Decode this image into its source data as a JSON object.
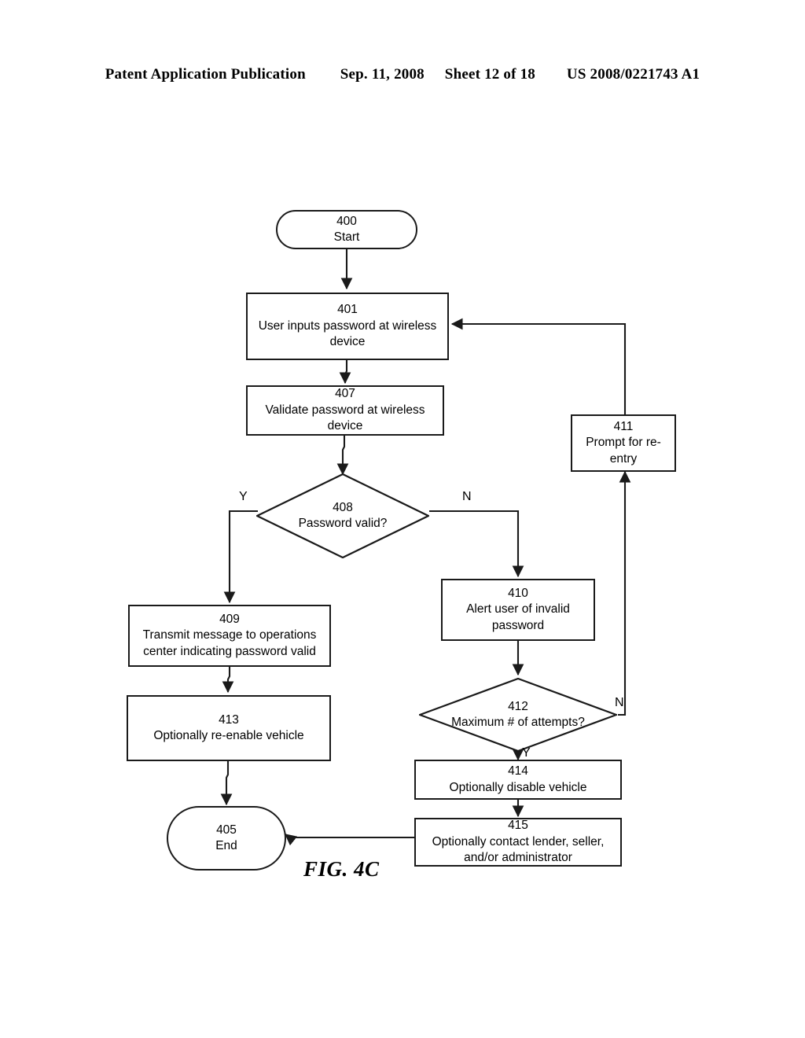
{
  "header": {
    "publication": "Patent Application Publication",
    "date": "Sep. 11, 2008",
    "sheet": "Sheet 12 of 18",
    "patent_number": "US 2008/0221743 A1"
  },
  "figure": {
    "caption": "FIG. 4C"
  },
  "nodes": {
    "n400": {
      "num": "400",
      "text": "Start"
    },
    "n401": {
      "num": "401",
      "text": "User inputs password at wireless device"
    },
    "n407": {
      "num": "407",
      "text": "Validate password at wireless device"
    },
    "n408": {
      "num": "408",
      "text": "Password valid?"
    },
    "n411": {
      "num": "411",
      "text": "Prompt for re-entry"
    },
    "n409": {
      "num": "409",
      "text": "Transmit message to operations center indicating password valid"
    },
    "n410": {
      "num": "410",
      "text": "Alert user of invalid password"
    },
    "n413": {
      "num": "413",
      "text": "Optionally re-enable vehicle"
    },
    "n412": {
      "num": "412",
      "text": "Maximum # of attempts?"
    },
    "n414": {
      "num": "414",
      "text": "Optionally disable vehicle"
    },
    "n415": {
      "num": "415",
      "text": "Optionally contact lender, seller, and/or administrator"
    },
    "n405": {
      "num": "405",
      "text": "End"
    }
  },
  "branch_labels": {
    "d408_yes": "Y",
    "d408_no": "N",
    "d412_no": "N",
    "d412_yes": "Y"
  },
  "colors": {
    "ink": "#1a1a1a",
    "paper": "#ffffff"
  }
}
